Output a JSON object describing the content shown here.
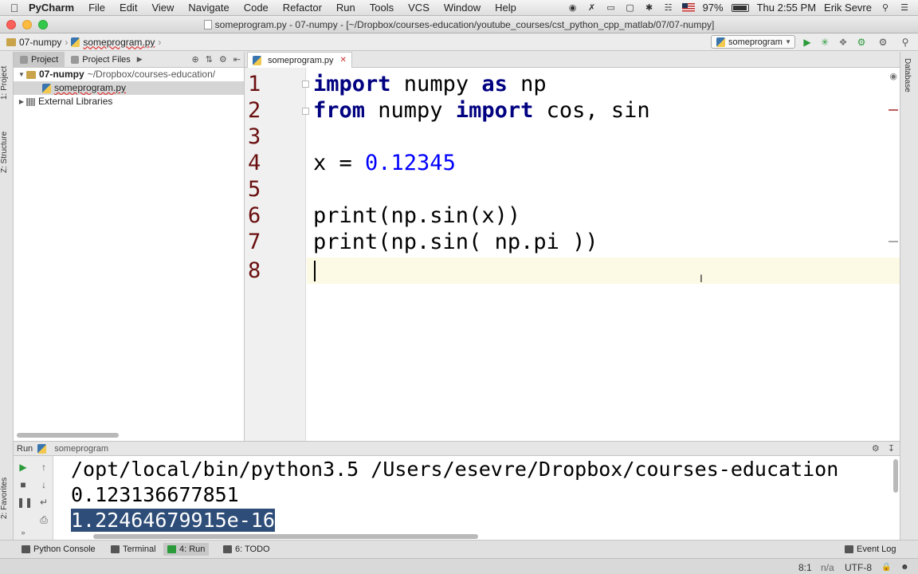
{
  "menubar": {
    "app_name": "PyCharm",
    "items": [
      "File",
      "Edit",
      "View",
      "Navigate",
      "Code",
      "Refactor",
      "Run",
      "Tools",
      "VCS",
      "Window",
      "Help"
    ],
    "battery": "97%",
    "clock": "Thu 2:55 PM",
    "user": "Erik Sevre"
  },
  "window": {
    "title": "someprogram.py - 07-numpy - [~/Dropbox/courses-education/youtube_courses/cst_python_cpp_matlab/07/07-numpy]"
  },
  "navbar": {
    "project": "07-numpy",
    "file": "someprogram.py",
    "run_config": "someprogram"
  },
  "project_panel": {
    "tabs": [
      "Project",
      "Project Files"
    ],
    "tree": [
      {
        "label": "07-numpy",
        "path": "~/Dropbox/courses-education/"
      },
      {
        "label": "someprogram.py"
      },
      {
        "label": "External Libraries"
      }
    ]
  },
  "side_tabs": {
    "project": "1: Project",
    "structure": "Z: Structure",
    "favorites": "2: Favorites",
    "database": "Database"
  },
  "editor": {
    "tab_label": "someprogram.py",
    "line_numbers": [
      "1",
      "2",
      "3",
      "4",
      "5",
      "6",
      "7",
      "8"
    ],
    "lines": {
      "l1": {
        "kw1": "import",
        "t1": " numpy ",
        "kw2": "as",
        "t2": " np"
      },
      "l2": {
        "kw1": "from",
        "t1": " numpy ",
        "kw2": "import",
        "t2": " cos, sin"
      },
      "l4": {
        "t1": "x = ",
        "num": "0.12345"
      },
      "l6": "print(np.sin(x))",
      "l7": "print(np.sin( np.pi ))"
    }
  },
  "run_panel": {
    "title": "Run",
    "config": "someprogram",
    "console": [
      "/opt/local/bin/python3.5 /Users/esevre/Dropbox/courses-education",
      "0.123136677851",
      "1.22464679915e-16"
    ]
  },
  "statusbar": {
    "tabs": [
      "Python Console",
      "Terminal",
      "4: Run",
      "6: TODO"
    ],
    "event_log": "Event Log",
    "position": "8:1",
    "na": "n/a",
    "encoding": "UTF-8"
  }
}
